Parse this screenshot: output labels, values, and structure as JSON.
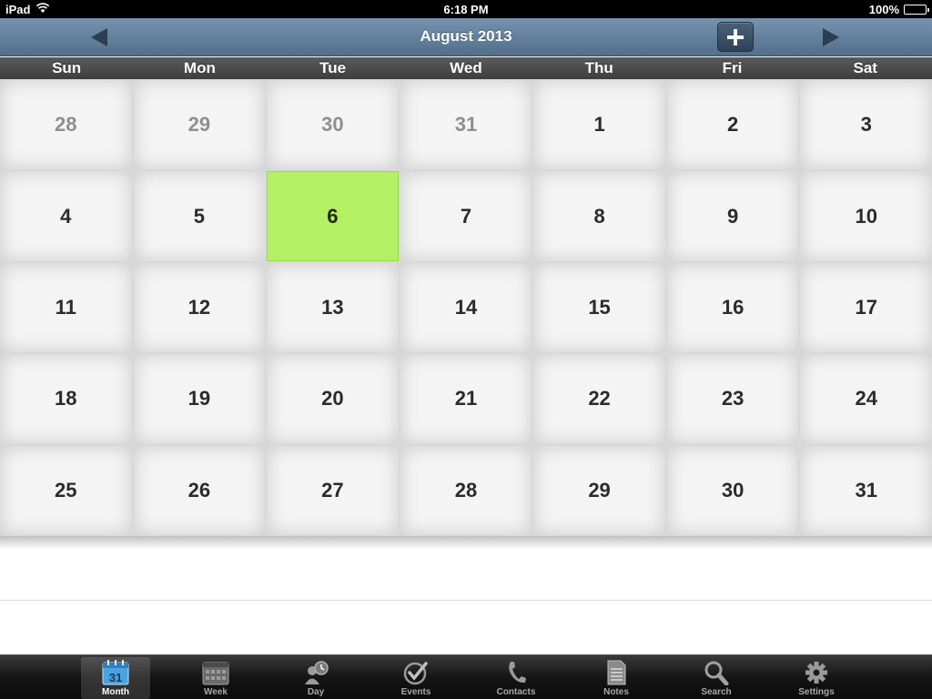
{
  "status_bar": {
    "device": "iPad",
    "time": "6:18 PM",
    "battery": "100%"
  },
  "header": {
    "title": "August 2013",
    "add_icon": "plus-icon",
    "prev_icon": "left-arrow-icon",
    "next_icon": "right-arrow-icon"
  },
  "weekdays": [
    "Sun",
    "Mon",
    "Tue",
    "Wed",
    "Thu",
    "Fri",
    "Sat"
  ],
  "calendar": {
    "weeks": [
      [
        {
          "d": "28",
          "other": true
        },
        {
          "d": "29",
          "other": true
        },
        {
          "d": "30",
          "other": true
        },
        {
          "d": "31",
          "other": true
        },
        {
          "d": "1"
        },
        {
          "d": "2"
        },
        {
          "d": "3"
        }
      ],
      [
        {
          "d": "4"
        },
        {
          "d": "5"
        },
        {
          "d": "6",
          "today": true
        },
        {
          "d": "7"
        },
        {
          "d": "8"
        },
        {
          "d": "9"
        },
        {
          "d": "10"
        }
      ],
      [
        {
          "d": "11"
        },
        {
          "d": "12"
        },
        {
          "d": "13"
        },
        {
          "d": "14"
        },
        {
          "d": "15"
        },
        {
          "d": "16"
        },
        {
          "d": "17"
        }
      ],
      [
        {
          "d": "18"
        },
        {
          "d": "19"
        },
        {
          "d": "20"
        },
        {
          "d": "21"
        },
        {
          "d": "22"
        },
        {
          "d": "23"
        },
        {
          "d": "24"
        }
      ],
      [
        {
          "d": "25"
        },
        {
          "d": "26"
        },
        {
          "d": "27"
        },
        {
          "d": "28"
        },
        {
          "d": "29"
        },
        {
          "d": "30"
        },
        {
          "d": "31"
        }
      ]
    ],
    "today_color": "#b3f063"
  },
  "tabs": [
    {
      "label": "Month",
      "icon": "calendar-icon",
      "icon_text": "31",
      "active": true
    },
    {
      "label": "Week",
      "icon": "week-grid-icon"
    },
    {
      "label": "Day",
      "icon": "day-clock-icon"
    },
    {
      "label": "Events",
      "icon": "checkmark-icon"
    },
    {
      "label": "Contacts",
      "icon": "phone-icon"
    },
    {
      "label": "Notes",
      "icon": "notes-icon"
    },
    {
      "label": "Search",
      "icon": "search-icon"
    },
    {
      "label": "Settings",
      "icon": "gear-icon"
    }
  ]
}
